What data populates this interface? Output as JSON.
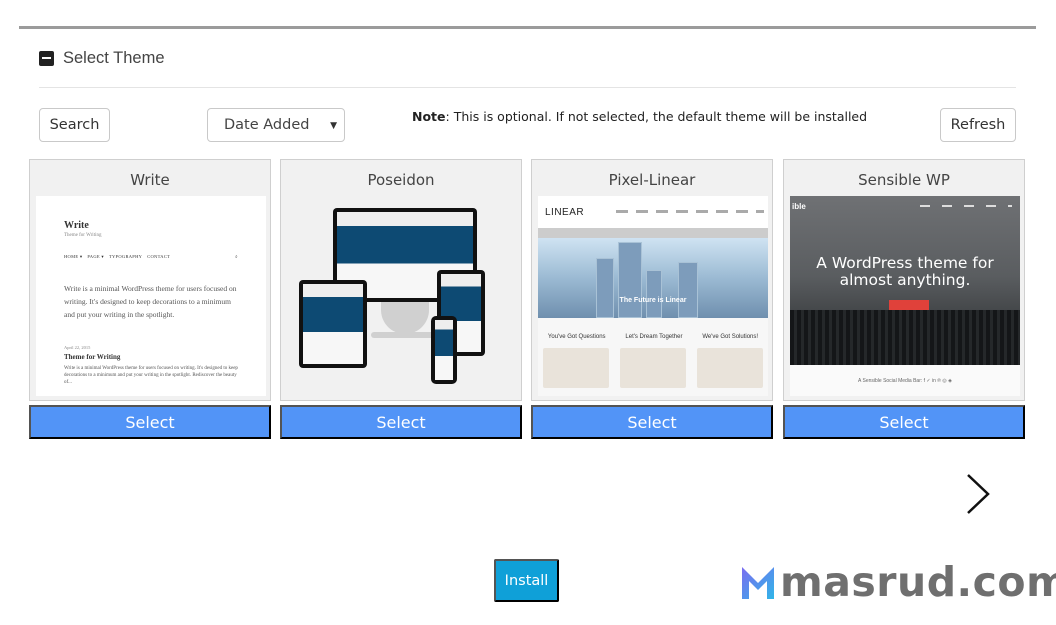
{
  "section": {
    "title": "Select Theme"
  },
  "toolbar": {
    "search_label": "Search",
    "sort_selected": "Date Added",
    "note_label": "Note",
    "note_text": ": This is optional. If not selected, the default theme will be installed",
    "refresh_label": "Refresh"
  },
  "themes": [
    {
      "name": "Write",
      "select_label": "Select",
      "preview": {
        "site_title": "Write",
        "tagline": "Theme for Writing",
        "nav": [
          "HOME ▾",
          "PAGE ▾",
          "TYPOGRAPHY",
          "CONTACT"
        ],
        "intro": "Write is a minimal WordPress theme for users focused on writing. It's designed to keep decorations to a minimum and put your writing in the spotlight.",
        "post_date": "April 22, 2015",
        "post_title": "Theme for Writing",
        "post_excerpt": "Write is a minimal WordPress theme for users focused on writing. It's designed to keep decorations to a minimum and put your writing in the spotlight. Rediscover the beauty of..."
      }
    },
    {
      "name": "Poseidon",
      "select_label": "Select",
      "preview": {
        "image": "responsive-devices-mockup"
      }
    },
    {
      "name": "Pixel-Linear",
      "select_label": "Select",
      "preview": {
        "logo": "LINEAR",
        "hero_caption": "The Future is Linear",
        "columns": [
          "You've Got Questions",
          "Let's Dream Together",
          "We've Got Solutions!"
        ]
      }
    },
    {
      "name": "Sensible WP",
      "select_label": "Select",
      "preview": {
        "brand": "ible",
        "hero_text": "A WordPress theme for almost anything.",
        "footer_text": "A Sensible Social Media Bar:  f  ✓  in  ℗  ◎  ◈"
      }
    }
  ],
  "pager": {
    "next_icon": "chevron-right-icon"
  },
  "actions": {
    "install_label": "Install"
  },
  "watermark": {
    "text": "masrud.com",
    "logo_icon": "m-logo-icon"
  },
  "colors": {
    "select_button": "#5294f7",
    "install_button": "#0fa0d8"
  }
}
